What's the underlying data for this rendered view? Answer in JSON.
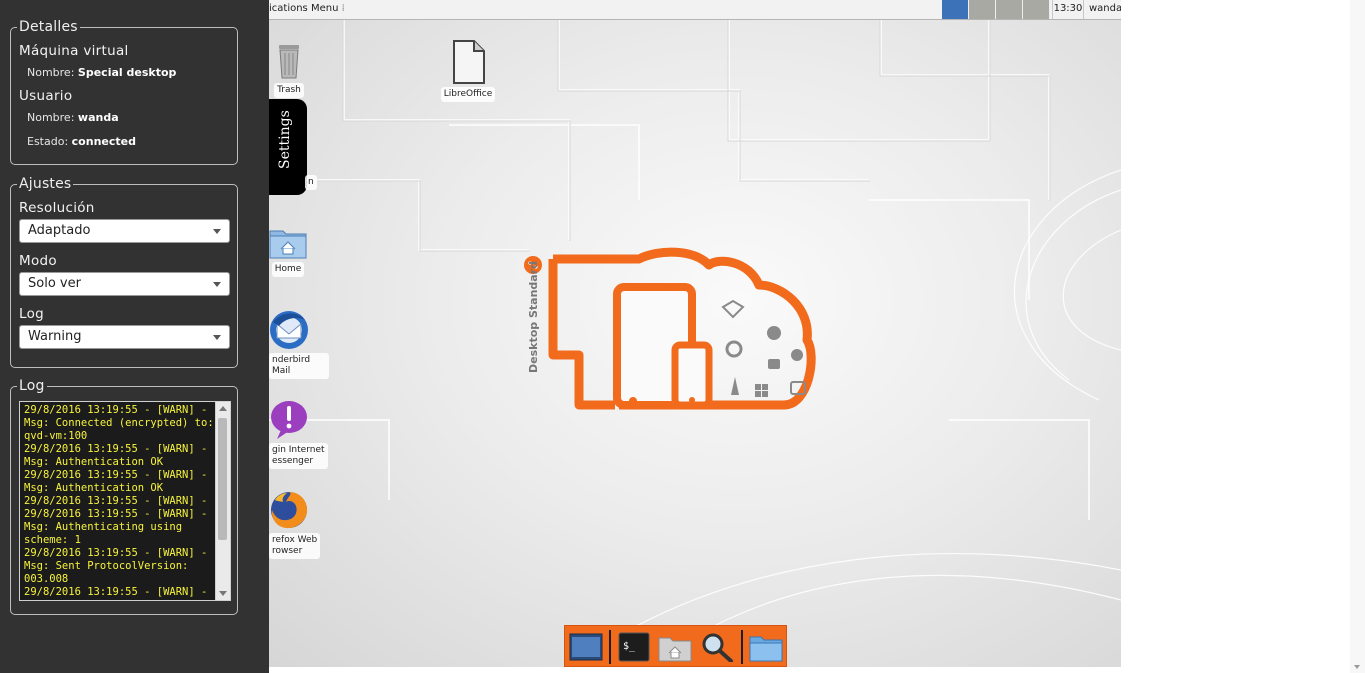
{
  "sidebar": {
    "details": {
      "legend": "Detalles",
      "vm_title": "Máquina virtual",
      "vm_name_label": "Nombre:",
      "vm_name_value": "Special desktop",
      "user_title": "Usuario",
      "user_name_label": "Nombre:",
      "user_name_value": "wanda",
      "user_state_label": "Estado:",
      "user_state_value": "connected"
    },
    "settings": {
      "legend": "Ajustes",
      "resolution_label": "Resolución",
      "resolution_value": "Adaptado",
      "mode_label": "Modo",
      "mode_value": "Solo ver",
      "log_label": "Log",
      "log_value": "Warning"
    },
    "log": {
      "legend": "Log",
      "lines": [
        "29/8/2016 13:19:55 - [WARN] - Msg: Connected (encrypted) to: qvd-vm:100",
        "29/8/2016 13:19:55 - [WARN] - Msg: Authentication OK",
        "29/8/2016 13:19:55 - [WARN] - Msg: Authentication OK",
        "29/8/2016 13:19:55 - [WARN] -",
        "29/8/2016 13:19:55 - [WARN] - Msg: Authenticating using scheme: 1",
        "29/8/2016 13:19:55 - [WARN] - Msg: Sent ProtocolVersion: 003.008",
        "29/8/2016 13:19:55 - [WARN] -"
      ]
    }
  },
  "desktop": {
    "topbar": {
      "apps_menu": "ications Menu",
      "clock": "13:30",
      "user": "wanda"
    },
    "icons": {
      "trash": "Trash",
      "libreoffice": "LibreOffice",
      "partial_label": "n",
      "home": "Home",
      "thunderbird": "nderbird Mail",
      "pidgin_line1": "gin Internet",
      "pidgin_line2": "essenger",
      "firefox_line1": "refox Web",
      "firefox_line2": "rowser"
    },
    "settings_tab": "Settings",
    "logo_text": "Desktop Standard",
    "colors": {
      "accent": "#f26a1b",
      "log_text": "#f7f33c",
      "sidebar_bg": "#323232"
    }
  }
}
